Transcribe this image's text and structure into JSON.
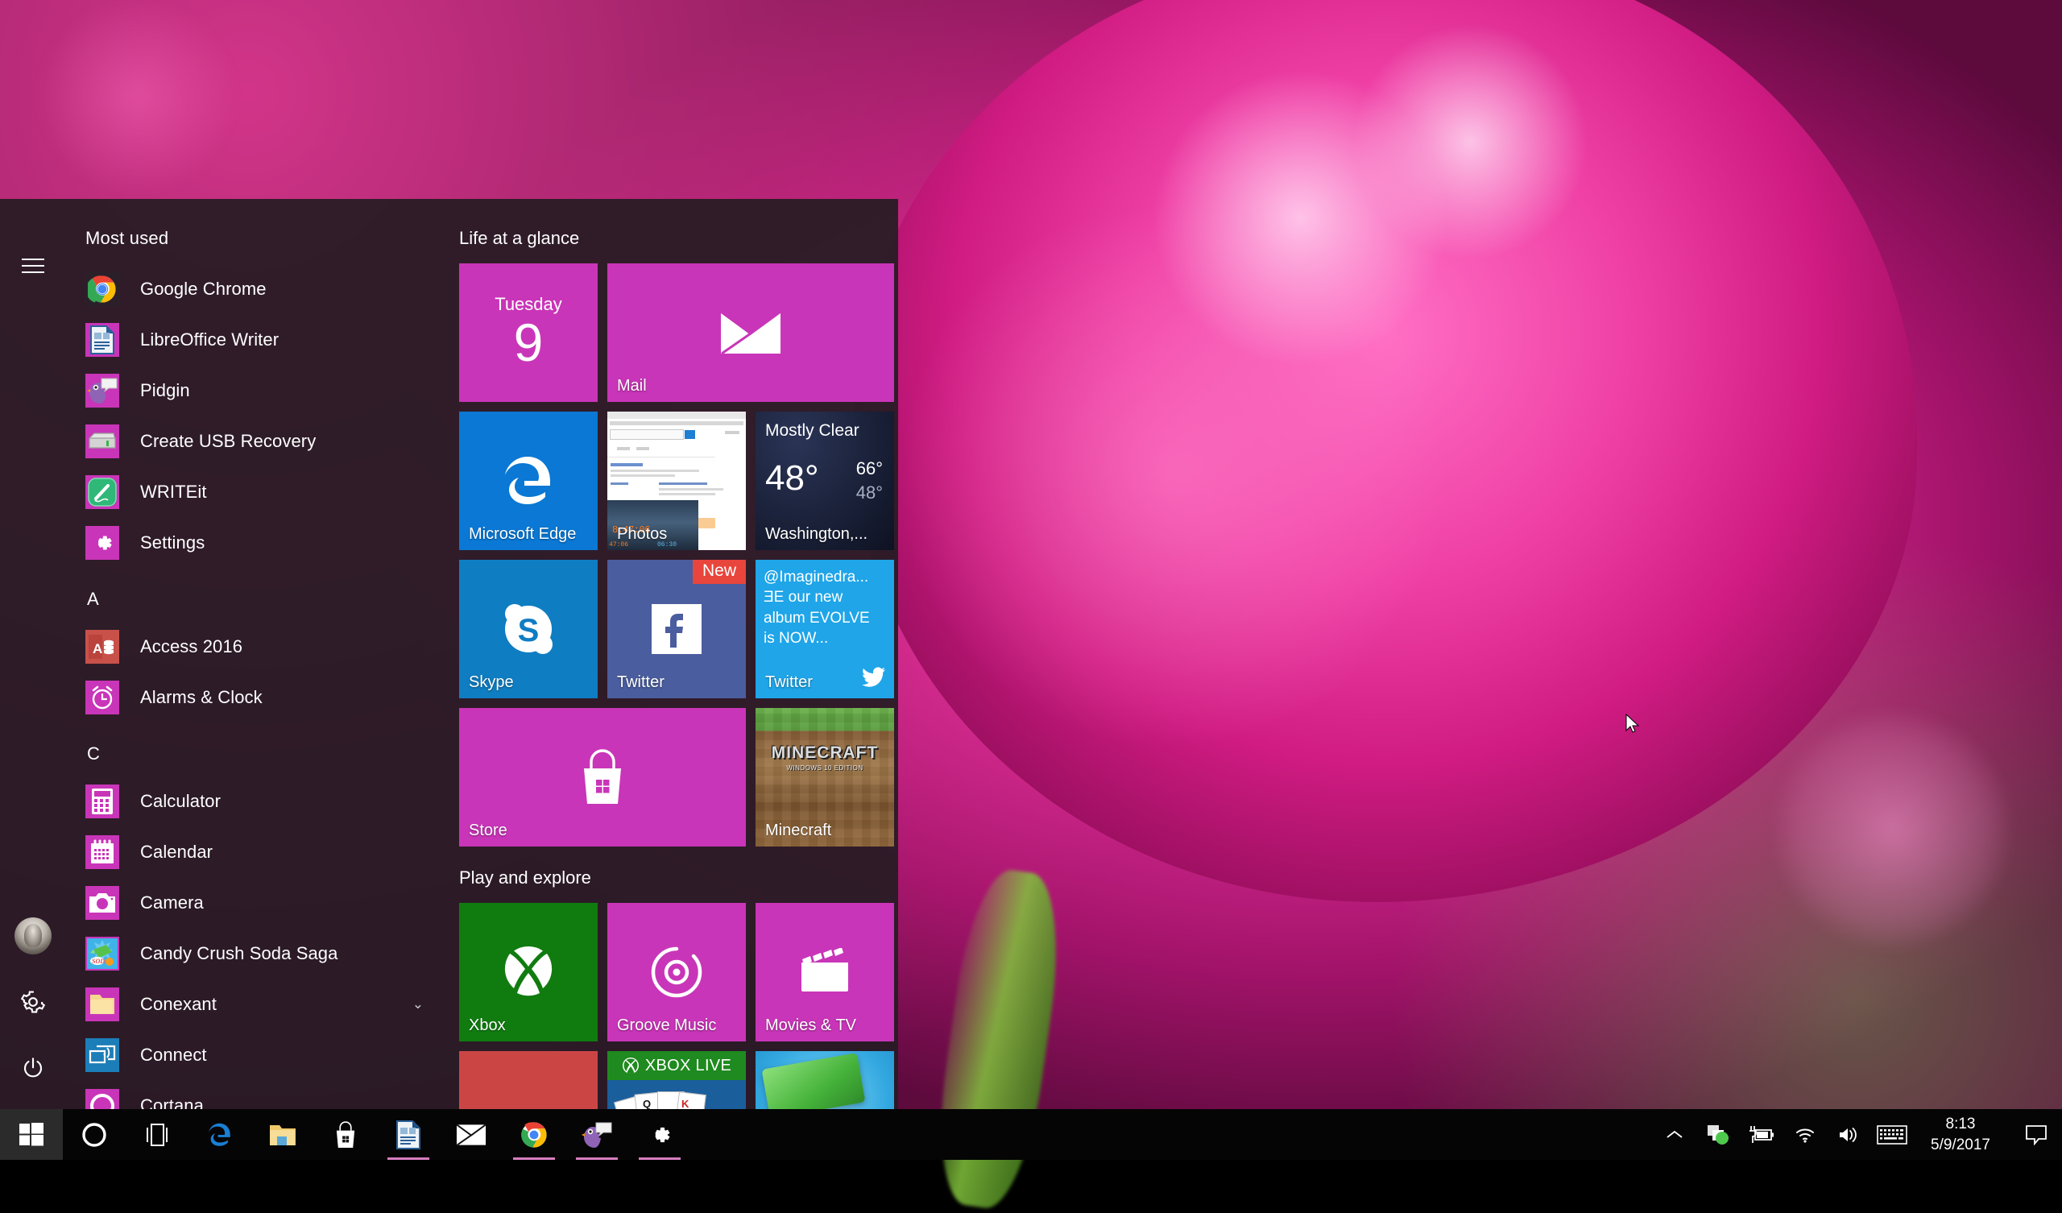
{
  "desktop": {
    "wallpaper_description": "pink chrysanthemum flower close-up"
  },
  "start_menu": {
    "rail": {
      "hamburger_label": "hamburger-menu",
      "account_label": "User account",
      "settings_label": "Settings",
      "power_label": "Power"
    },
    "app_list": {
      "header": "Most used",
      "most_used": [
        {
          "label": "Google Chrome",
          "icon": "chrome-icon",
          "tile_color": "#2b2029"
        },
        {
          "label": "LibreOffice Writer",
          "icon": "libreoffice-writer-icon",
          "tile_color": "#c935b8"
        },
        {
          "label": "Pidgin",
          "icon": "pidgin-icon",
          "tile_color": "#c935b8"
        },
        {
          "label": "Create USB Recovery",
          "icon": "usb-drive-icon",
          "tile_color": "#c935b8"
        },
        {
          "label": "WRITEit",
          "icon": "writeit-icon",
          "tile_color": "#c935b8"
        },
        {
          "label": "Settings",
          "icon": "gear-icon",
          "tile_color": "#c935b8"
        }
      ],
      "groups": [
        {
          "letter": "A",
          "items": [
            {
              "label": "Access 2016",
              "icon": "access-icon",
              "tile_color": "#c8514a",
              "expandable": false
            },
            {
              "label": "Alarms & Clock",
              "icon": "alarm-clock-icon",
              "tile_color": "#c935b8",
              "expandable": false
            }
          ]
        },
        {
          "letter": "C",
          "items": [
            {
              "label": "Calculator",
              "icon": "calculator-icon",
              "tile_color": "#c935b8",
              "expandable": false
            },
            {
              "label": "Calendar",
              "icon": "calendar-icon",
              "tile_color": "#c935b8",
              "expandable": false
            },
            {
              "label": "Camera",
              "icon": "camera-icon",
              "tile_color": "#c935b8",
              "expandable": false
            },
            {
              "label": "Candy Crush Soda Saga",
              "icon": "candy-crush-soda-icon",
              "tile_color": "#c935b8",
              "expandable": false
            },
            {
              "label": "Conexant",
              "icon": "folder-icon",
              "tile_color": "#c935b8",
              "expandable": true
            },
            {
              "label": "Connect",
              "icon": "connect-cast-icon",
              "tile_color": "#1c7eb8",
              "expandable": false
            },
            {
              "label": "Cortana",
              "icon": "cortana-icon",
              "tile_color": "#c935b8",
              "expandable": false
            }
          ]
        }
      ],
      "expand_chevron": "⌄"
    },
    "tile_groups": [
      {
        "title": "Life at a glance",
        "tiles": [
          {
            "name": "Calendar",
            "label": "",
            "kind": "calendar",
            "color": "#c935b8",
            "size": "medium",
            "day_name": "Tuesday",
            "day_number": "9"
          },
          {
            "name": "Mail",
            "label": "Mail",
            "kind": "mail",
            "color": "#c935b8",
            "size": "wide"
          },
          {
            "name": "Microsoft Edge",
            "label": "Microsoft Edge",
            "kind": "edge",
            "color": "#0a78d4",
            "size": "medium"
          },
          {
            "name": "Photos",
            "label": "Photos",
            "kind": "photos",
            "color": "#ffffff",
            "size": "medium"
          },
          {
            "name": "Weather",
            "label": "",
            "kind": "weather",
            "color": "#1c2340",
            "size": "medium",
            "condition": "Mostly Clear",
            "current_temp": "48°",
            "high_temp": "66°",
            "low_temp": "48°",
            "location": "Washington,..."
          },
          {
            "name": "Skype",
            "label": "Skype",
            "kind": "skype",
            "color": "#0f7dc2",
            "size": "medium"
          },
          {
            "name": "Facebook",
            "label": "Facebook",
            "kind": "facebook",
            "color": "#4a5d9e",
            "size": "medium",
            "badge": "New",
            "badge_color": "#e8453c"
          },
          {
            "name": "Twitter",
            "label": "Twitter",
            "kind": "twitter",
            "color": "#1fa5e8",
            "size": "medium",
            "tweet_lines": [
              "@Imaginedra...",
              "ƎE our new",
              "album EVOLVE",
              "is NOW..."
            ]
          },
          {
            "name": "Store",
            "label": "Store",
            "kind": "store",
            "color": "#c935b8",
            "size": "wide"
          },
          {
            "name": "Minecraft",
            "label": "Minecraft",
            "kind": "minecraft",
            "color": "#8b6a43",
            "size": "medium",
            "logo_text": "MINECRAFT",
            "logo_sub": "WINDOWS 10 EDITION"
          }
        ]
      },
      {
        "title": "Play and explore",
        "tiles": [
          {
            "name": "Xbox",
            "label": "Xbox",
            "kind": "xbox",
            "color": "#107c10",
            "size": "medium"
          },
          {
            "name": "Groove Music",
            "label": "Groove Music",
            "kind": "groove",
            "color": "#c935b8",
            "size": "medium"
          },
          {
            "name": "Movies & TV",
            "label": "Movies & TV",
            "kind": "movies",
            "color": "#c935b8",
            "size": "medium"
          },
          {
            "name": "Red app tile",
            "label": "",
            "kind": "plain-red",
            "color": "#cc4545",
            "size": "medium"
          },
          {
            "name": "Microsoft Solitaire Collection",
            "label": "",
            "kind": "solitaire",
            "color": "#1b5e9c",
            "size": "medium",
            "banner_text": "XBOX LIVE"
          },
          {
            "name": "Candy Crush Soda Saga",
            "label": "",
            "kind": "candy",
            "color": "#2aa6e0",
            "size": "medium"
          }
        ]
      }
    ]
  },
  "taskbar": {
    "start_label": "Start",
    "items": [
      {
        "name": "cortana-search",
        "icon": "cortana-circle-icon",
        "running": false
      },
      {
        "name": "task-view",
        "icon": "task-view-icon",
        "running": false
      },
      {
        "name": "microsoft-edge",
        "icon": "edge-icon",
        "running": false
      },
      {
        "name": "file-explorer",
        "icon": "folder-icon",
        "running": false
      },
      {
        "name": "store",
        "icon": "store-bag-icon",
        "running": false
      },
      {
        "name": "libreoffice-writer",
        "icon": "libreoffice-writer-icon",
        "running": true
      },
      {
        "name": "mail",
        "icon": "mail-envelope-icon",
        "running": false
      },
      {
        "name": "google-chrome",
        "icon": "chrome-icon",
        "running": true
      },
      {
        "name": "pidgin",
        "icon": "pidgin-icon",
        "running": true
      },
      {
        "name": "settings",
        "icon": "gear-icon",
        "running": true
      }
    ],
    "tray": {
      "overflow_icon": "chevron-up-icon",
      "icons": [
        {
          "name": "onedrive-sync-icon"
        },
        {
          "name": "battery-charging-icon"
        },
        {
          "name": "wifi-icon"
        },
        {
          "name": "volume-icon"
        },
        {
          "name": "touch-keyboard-icon"
        }
      ],
      "time": "8:13",
      "date": "5/9/2017",
      "action_center_icon": "action-center-icon"
    }
  }
}
